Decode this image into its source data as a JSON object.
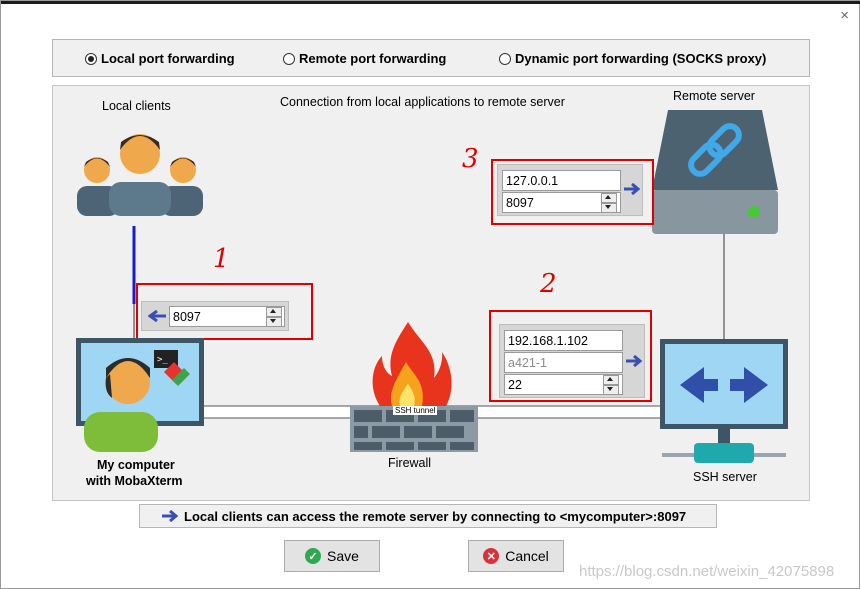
{
  "window": {
    "close_glyph": "×"
  },
  "modes": [
    {
      "label": "Local port forwarding",
      "selected": true
    },
    {
      "label": "Remote port forwarding",
      "selected": false
    },
    {
      "label": "Dynamic port forwarding (SOCKS proxy)",
      "selected": false
    }
  ],
  "diagram": {
    "local_clients_label": "Local clients",
    "connection_label": "Connection from local applications to remote server",
    "remote_server_label": "Remote server",
    "my_computer_label_line1": "My computer",
    "my_computer_label_line2": "with MobaXterm",
    "firewall_label": "Firewall",
    "tunnel_label": "SSH tunnel",
    "ssh_server_label": "SSH server",
    "local_port": "8097",
    "remote_host": "127.0.0.1",
    "remote_port": "8097",
    "ssh_host": "192.168.1.102",
    "ssh_user": "a421-1",
    "ssh_port": "22"
  },
  "annotations": {
    "one": "1",
    "two": "2",
    "three": "3"
  },
  "info": {
    "text": "Local clients can access the remote server by connecting to <mycomputer>:8097"
  },
  "buttons": {
    "save": "Save",
    "cancel": "Cancel"
  },
  "watermark": "https://blog.csdn.net/weixin_42075898",
  "colors": {
    "accent_blue": "#3a4fb0",
    "annotation_red": "#e00000",
    "save_green": "#2fa84f",
    "cancel_red": "#d9303a"
  }
}
